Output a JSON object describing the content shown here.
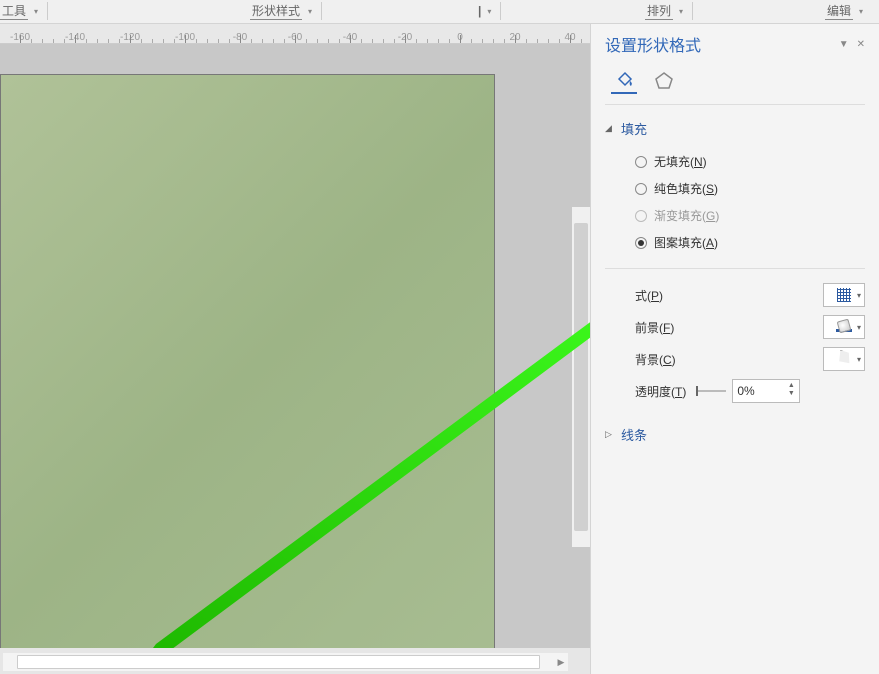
{
  "topbar": {
    "group1": "工具",
    "group2": "形状样式",
    "group3": "排列",
    "group4": "编辑"
  },
  "ruler": {
    "labels": [
      "-160",
      "-140",
      "-120",
      "-100",
      "-80",
      "-60",
      "-40",
      "-20",
      "0",
      "20",
      "40"
    ]
  },
  "panel": {
    "title": "设置形状格式",
    "sections": {
      "fill": {
        "label": "填充",
        "options": {
          "none": "无填充(",
          "none_key": "N",
          "solid": "纯色填充(",
          "solid_key": "S",
          "gradient": "渐变填充(",
          "gradient_key": "G",
          "pattern": "图案填充(",
          "pattern_key": "A"
        },
        "props": {
          "pattern_label": "式(",
          "pattern_key": "P",
          "fg_label": "前景(",
          "fg_key": "F",
          "bg_label": "背景(",
          "bg_key": "C",
          "transparency_label": "透明度(",
          "transparency_key": "T",
          "transparency_value": "0%"
        }
      },
      "line": {
        "label": "线条"
      }
    }
  }
}
